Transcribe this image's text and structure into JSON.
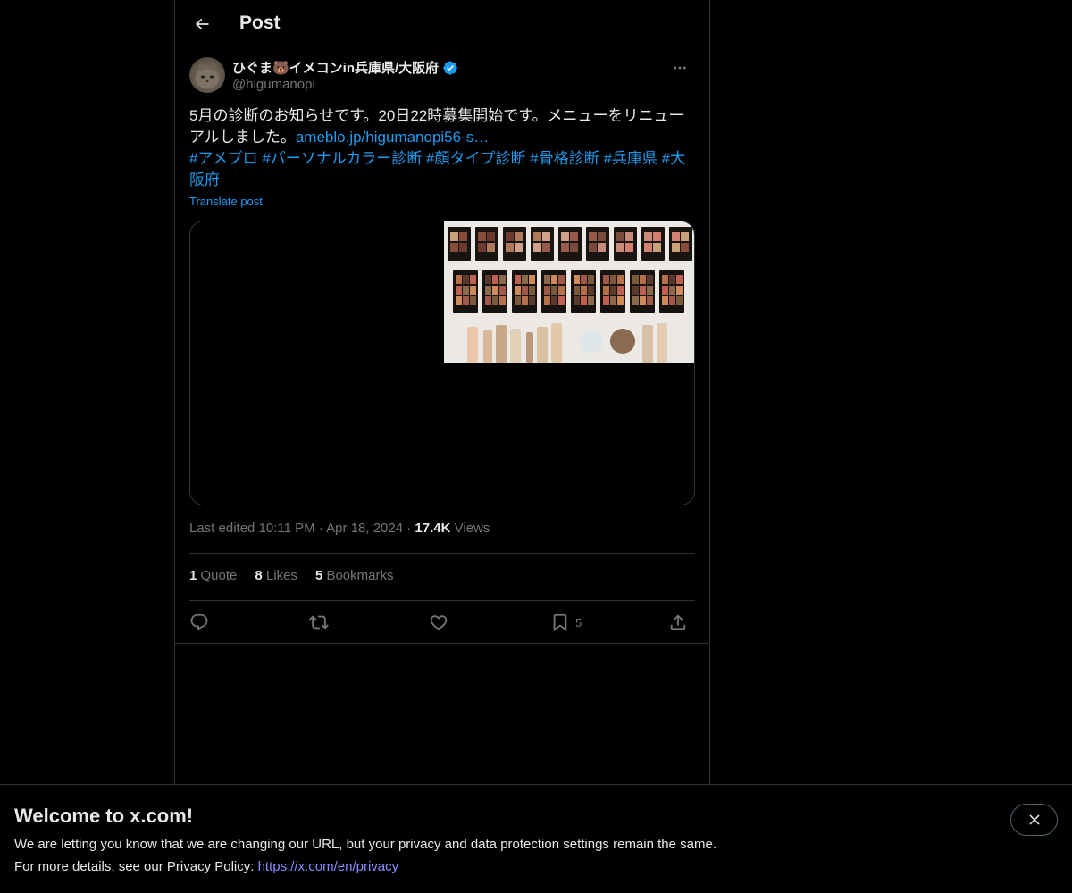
{
  "header": {
    "title": "Post"
  },
  "author": {
    "display_name": "ひぐま🐻イメコンin兵庫県/大阪府",
    "handle": "@higumanopi",
    "verified": true
  },
  "tweet": {
    "text": "5月の診断のお知らせです。20日22時募集開始です。メニューをリニューアルしました。",
    "link": "ameblo.jp/higumanopi56-s…",
    "hashtags": [
      "#アメブロ",
      "#パーソナルカラー診断",
      "#顔タイプ診断",
      "#骨格診断",
      "#兵庫県",
      "#大阪府"
    ],
    "translate_label": "Translate post"
  },
  "meta": {
    "edited_label": "Last edited 10:11 PM",
    "date": "Apr 18, 2024",
    "views_count": "17.4K",
    "views_label": "Views"
  },
  "stats": {
    "quotes_count": "1",
    "quotes_label": "Quote",
    "likes_count": "8",
    "likes_label": "Likes",
    "bookmarks_count": "5",
    "bookmarks_label": "Bookmarks"
  },
  "actions": {
    "reply_icon": "reply-icon",
    "repost_icon": "repost-icon",
    "like_icon": "heart-icon",
    "bookmark_icon": "bookmark-icon",
    "bookmark_count": "5",
    "share_icon": "share-icon"
  },
  "banner": {
    "title": "Welcome to x.com!",
    "line1": "We are letting you know that we are changing our URL, but your privacy and data protection settings remain the same.",
    "line2_prefix": "For more details, see our Privacy Policy: ",
    "link": "https://x.com/en/privacy"
  },
  "colors": {
    "background": "#000000",
    "text": "#e7e9ea",
    "muted": "#71767b",
    "accent": "#1d9bf0",
    "border": "#2f3336",
    "privacy_link": "#8b8bff"
  }
}
